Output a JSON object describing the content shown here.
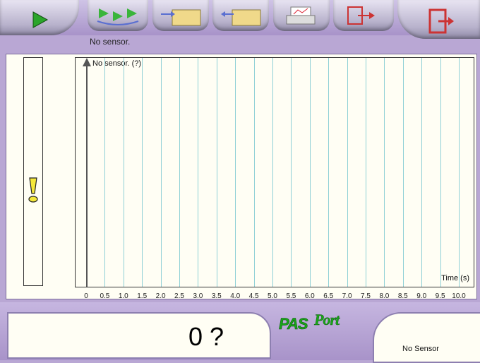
{
  "toolbar": {
    "buttons": [
      {
        "name": "start-button",
        "icon": "play-icon"
      },
      {
        "name": "setup-button",
        "icon": "sensor-loop-icon"
      },
      {
        "name": "import-button",
        "icon": "folder-import-icon"
      },
      {
        "name": "export-button",
        "icon": "folder-export-icon"
      },
      {
        "name": "print-button",
        "icon": "printer-icon"
      },
      {
        "name": "tools-button",
        "icon": "exit-tools-icon"
      },
      {
        "name": "exit-button",
        "icon": "door-exit-icon"
      }
    ]
  },
  "status": {
    "text": "No sensor."
  },
  "graph": {
    "y_label": "No sensor. (?)",
    "x_label": "Time (s)",
    "x_ticks": [
      "0",
      "0.5",
      "1.0",
      "1.5",
      "2.0",
      "2.5",
      "3.0",
      "3.5",
      "4.0",
      "4.5",
      "5.0",
      "5.5",
      "6.0",
      "6.5",
      "7.0",
      "7.5",
      "8.0",
      "8.5",
      "9.0",
      "9.5",
      "10.0"
    ],
    "colors": {
      "grid": "#8fd0d6",
      "background": "#fffef4"
    }
  },
  "readout": {
    "value": "0 ?"
  },
  "brand": {
    "logo": "PASPort"
  },
  "sensor_panel": {
    "text": "No Sensor"
  },
  "meter": {
    "icon": "warning-icon",
    "color": "#f5e83a"
  }
}
